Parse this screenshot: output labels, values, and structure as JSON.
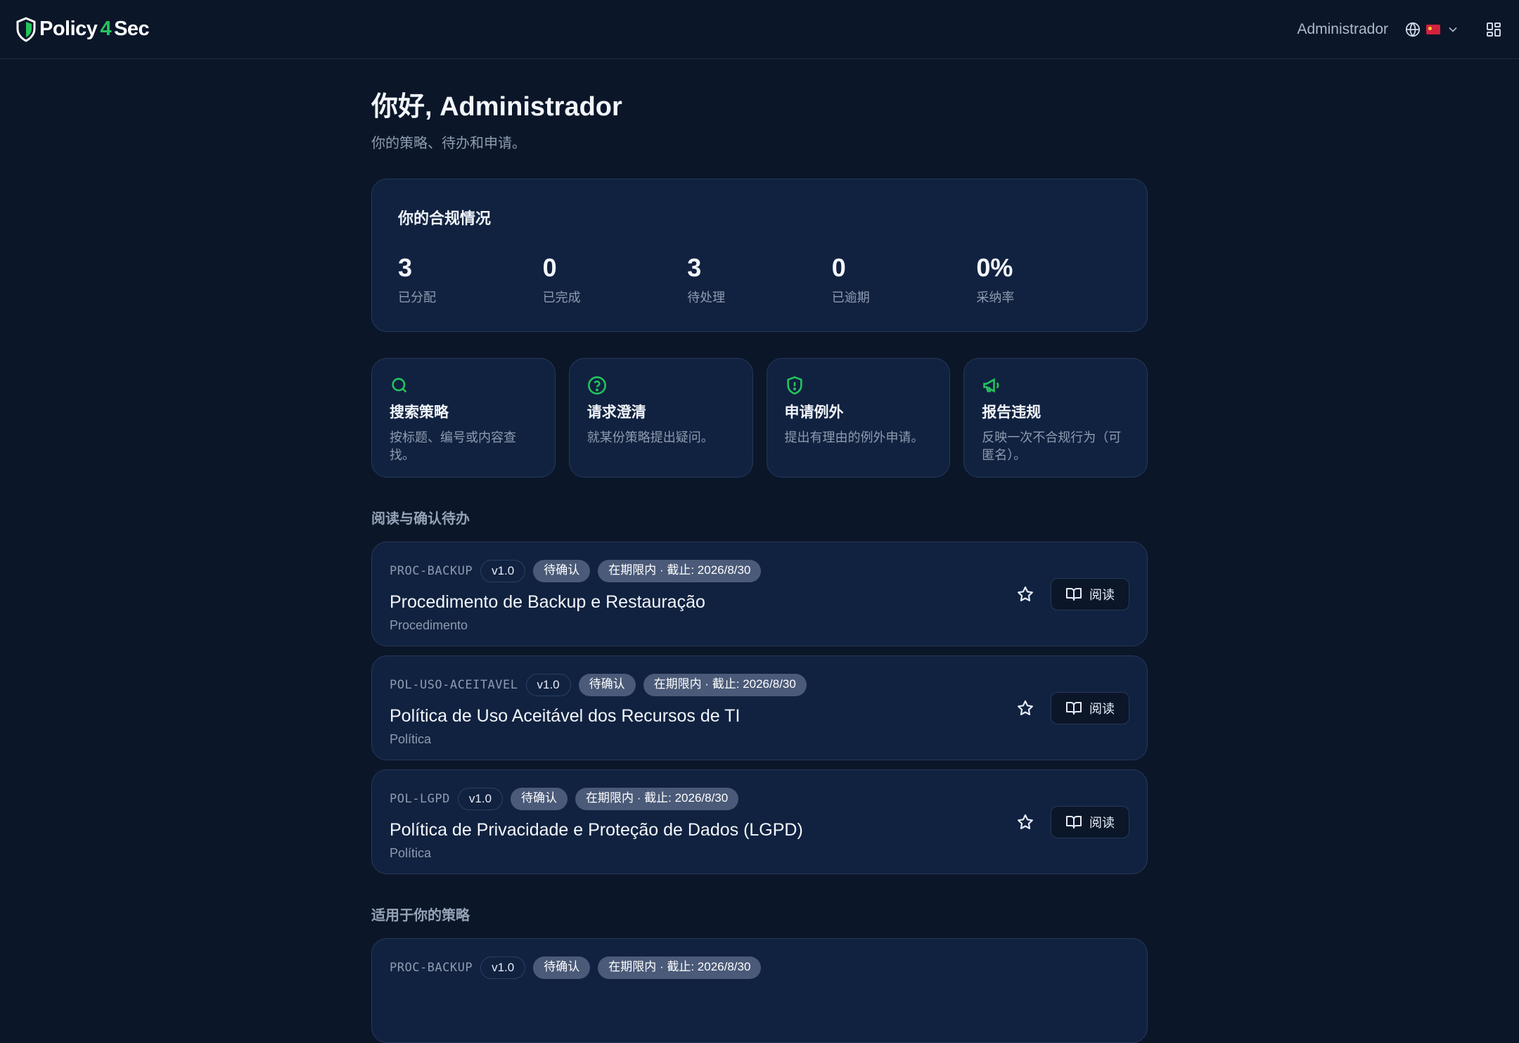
{
  "header": {
    "brand_left": "Policy",
    "brand_mid": "4",
    "brand_right": "Sec",
    "user": "Administrador",
    "language_flag": "china-flag",
    "grid_icon": "grid-icon"
  },
  "greeting": {
    "title": "你好, Administrador",
    "subtitle": "你的策略、待办和申请。"
  },
  "compliance": {
    "title": "你的合规情况",
    "stats": [
      {
        "value": "3",
        "label": "已分配"
      },
      {
        "value": "0",
        "label": "已完成"
      },
      {
        "value": "3",
        "label": "待处理"
      },
      {
        "value": "0",
        "label": "已逾期"
      },
      {
        "value": "0%",
        "label": "采纳率"
      }
    ]
  },
  "actions": [
    {
      "icon": "search-icon",
      "title": "搜索策略",
      "desc": "按标题、编号或内容查找。"
    },
    {
      "icon": "question-circle-icon",
      "title": "请求澄清",
      "desc": "就某份策略提出疑问。"
    },
    {
      "icon": "shield-alert-icon",
      "title": "申请例外",
      "desc": "提出有理由的例外申请。"
    },
    {
      "icon": "megaphone-icon",
      "title": "报告违规",
      "desc": "反映一次不合规行为（可匿名）。"
    }
  ],
  "pending_section": {
    "title": "阅读与确认待办",
    "items": [
      {
        "code": "PROC-BACKUP",
        "version": "v1.0",
        "status": "待确认",
        "due": "在期限内 · 截止: 2026/8/30",
        "title": "Procedimento de Backup e Restauração",
        "type": "Procedimento",
        "read_label": "阅读"
      },
      {
        "code": "POL-USO-ACEITAVEL",
        "version": "v1.0",
        "status": "待确认",
        "due": "在期限内 · 截止: 2026/8/30",
        "title": "Política de Uso Aceitável dos Recursos de TI",
        "type": "Política",
        "read_label": "阅读"
      },
      {
        "code": "POL-LGPD",
        "version": "v1.0",
        "status": "待确认",
        "due": "在期限内 · 截止: 2026/8/30",
        "title": "Política de Privacidade e Proteção de Dados (LGPD)",
        "type": "Política",
        "read_label": "阅读"
      }
    ]
  },
  "applicable_section": {
    "title": "适用于你的策略",
    "items": [
      {
        "code": "PROC-BACKUP",
        "version": "v1.0",
        "status": "待确认",
        "due": "在期限内 · 截止: 2026/8/30"
      }
    ]
  },
  "colors": {
    "accent": "#22c55e",
    "background": "#0b1629",
    "card": "#112240"
  }
}
